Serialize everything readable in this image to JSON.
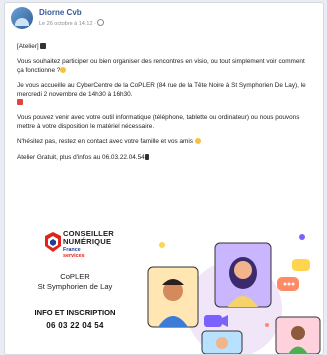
{
  "post": {
    "author": "Diorne Cvb",
    "meta": "Le 26 octobre à 14:12 · ",
    "paragraphs": {
      "p1": "[Atelier]",
      "p2": "Vous souhaitez participer ou bien organiser des rencontres en visio, ou tout simplement voir comment ça fonctionne ?",
      "p3": "Je vous accueille au CyberCentre de la CoPLER (84 rue de la Tête Noire à St Symphorien De Lay), le mercredi 2 novembre de 14h30 à 16h30.",
      "p4": "Vous pouvez venir avec votre outil informatique (téléphone, tablette ou ordinateur) ou nous pouvons mettre à votre disposition le matériel nécessaire.",
      "p5": "N'hésitez pas, restez en contact avec votre famille et vos amis",
      "p6": "Atelier Gratuit, plus d'infos au 06.03.22.04.54"
    }
  },
  "flyer": {
    "logo_line1": "CONSEILLER",
    "logo_line2": "NUMÉRIQUE",
    "logo_line3": "France",
    "logo_line4": "services",
    "org": "CoPLER",
    "place": "St Symphorien de Lay",
    "info_label": "INFO ET INSCRIPTION",
    "phone": "06 03 22 04 54"
  },
  "colors": {
    "link": "#385898",
    "france_blue": "#1f3f97",
    "france_red": "#e2231a"
  },
  "icons": [
    "globe-icon",
    "clapper-icon",
    "smile-emoji-icon",
    "calendar-icon",
    "sunglasses-emoji-icon",
    "phone-icon",
    "france-services-logo"
  ]
}
